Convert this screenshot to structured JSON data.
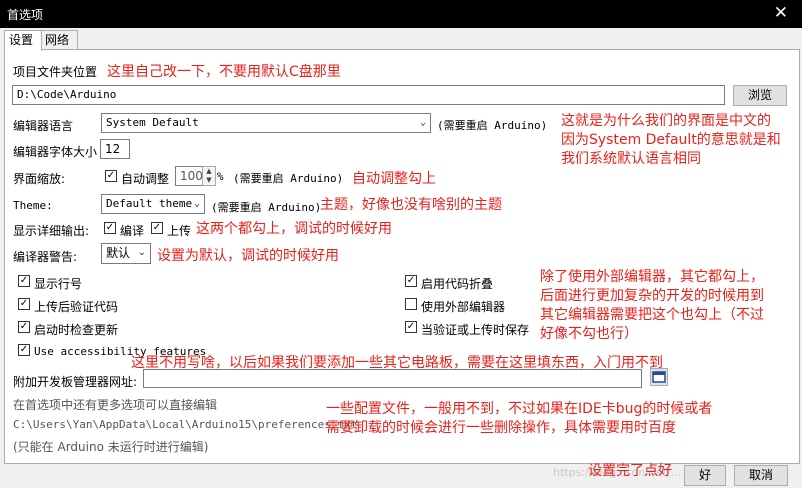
{
  "window": {
    "title": "首选项",
    "close_glyph": "✕"
  },
  "tabs": [
    {
      "label": "设置"
    },
    {
      "label": "网络"
    }
  ],
  "sketchbook": {
    "label": "项目文件夹位置",
    "value": "D:\\Code\\Arduino",
    "browse": "浏览"
  },
  "language": {
    "label": "编辑器语言",
    "value": "System Default",
    "note": "(需要重启 Arduino)"
  },
  "fontsize": {
    "label": "编辑器字体大小",
    "value": "12"
  },
  "scaling": {
    "label": "界面缩放:",
    "auto": "自动调整",
    "value": "100",
    "unit": "%",
    "note": "(需要重启 Arduino)"
  },
  "theme": {
    "label": "Theme:",
    "value": "Default theme",
    "note": "(需要重启 Arduino)"
  },
  "verbose": {
    "label": "显示详细输出:",
    "compile": "编译",
    "upload": "上传"
  },
  "warnings": {
    "label": "编译器警告:",
    "value": "默认"
  },
  "checkboxes": {
    "line_numbers": "显示行号",
    "verify_upload": "上传后验证代码",
    "check_updates": "启动时检查更新",
    "accessibility": "Use accessibility features",
    "code_folding": "启用代码折叠",
    "external_editor": "使用外部编辑器",
    "save_on_verify": "当验证或上传时保存"
  },
  "boards_manager": {
    "label": "附加开发板管理器网址:",
    "value": ""
  },
  "more_prefs": {
    "hint": "在首选项中还有更多选项可以直接编辑",
    "path": "C:\\Users\\Yan\\AppData\\Local\\Arduino15\\preferences.txt",
    "only_when": "(只能在 Arduino 未运行时进行编辑)"
  },
  "footer": {
    "ok": "好",
    "cancel": "取消",
    "watermark": "https://blog.csdn.net/..."
  },
  "annotations": {
    "a1": "这里自己改一下，不要用默认C盘那里",
    "a2_1": "这就是为什么我们的界面是中文的",
    "a2_2": "因为System Default的意思就是和",
    "a2_3": "我们系统默认语言相同",
    "a3": "自动调整勾上",
    "a4": "主题，好像也没有啥别的主题",
    "a5": "这两个都勾上，调试的时候好用",
    "a6": "设置为默认，调试的时候好用",
    "a7_1": "除了使用外部编辑器，其它都勾上，",
    "a7_2": "后面进行更加复杂的开发的时候用到",
    "a7_3": "其它编辑器需要把这个也勾上（不过",
    "a7_4": "好像不勾也行）",
    "a8": "这里不用写啥，以后如果我们要添加一些其它电路板，需要在这里填东西，入门用不到",
    "a9_1": "一些配置文件，一般用不到，不过如果在IDE卡bug的时候或者",
    "a9_2": "需要卸载的时候会进行一些删除操作，具体需要用时百度",
    "a10": "设置完了点好"
  },
  "colors": {
    "annotation": "#e8211c",
    "titlebar": "#000000",
    "panel": "#ffffff",
    "dialog": "#f0f0f0"
  }
}
